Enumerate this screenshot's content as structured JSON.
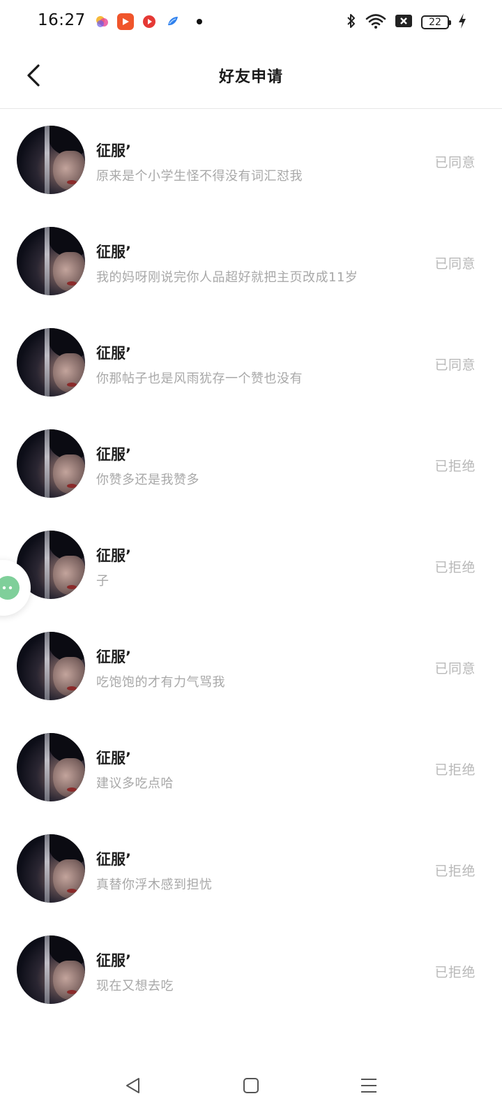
{
  "status_bar": {
    "time": "16:27",
    "battery": "22",
    "app_icons": [
      "colorful-app-icon",
      "video-play-app-icon",
      "red-video-app-icon",
      "blue-app-icon"
    ],
    "system_icons": [
      "bluetooth-icon",
      "wifi-icon",
      "no-sim-icon",
      "battery-icon",
      "charging-icon"
    ]
  },
  "header": {
    "title": "好友申请"
  },
  "requests": [
    {
      "name": "征服’",
      "message": "原来是个小学生怪不得没有词汇怼我",
      "status": "已同意"
    },
    {
      "name": "征服’",
      "message": "我的妈呀刚说完你人品超好就把主页改成11岁",
      "status": "已同意"
    },
    {
      "name": "征服’",
      "message": "你那帖子也是风雨犹存一个赞也没有",
      "status": "已同意"
    },
    {
      "name": "征服’",
      "message": "你赞多还是我赞多",
      "status": "已拒绝"
    },
    {
      "name": "征服’",
      "message": "子",
      "status": "已拒绝"
    },
    {
      "name": "征服’",
      "message": "吃饱饱的才有力气骂我",
      "status": "已同意"
    },
    {
      "name": "征服’",
      "message": "建议多吃点哈",
      "status": "已拒绝"
    },
    {
      "name": "征服’",
      "message": "真替你浮木感到担忧",
      "status": "已拒绝"
    },
    {
      "name": "征服’",
      "message": "现在又想去吃",
      "status": "已拒绝"
    }
  ],
  "colors": {
    "status_text": "#b8b8b8",
    "message_text": "#a8a8a8",
    "name_text": "#1e1e1e",
    "bubble_accent": "#7fcf9a"
  }
}
